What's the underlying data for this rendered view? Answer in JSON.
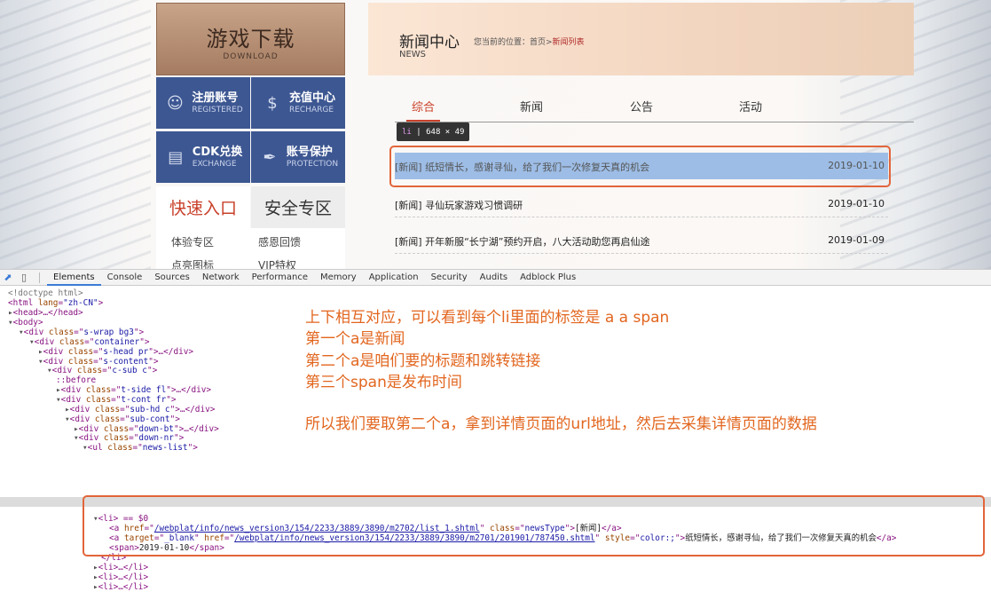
{
  "sidebar": {
    "download": {
      "title": "游戏下载",
      "subtitle": "DOWNLOAD"
    },
    "tiles": [
      {
        "title": "注册账号",
        "subtitle": "REGISTERED",
        "icon": "user-register-icon"
      },
      {
        "title": "充值中心",
        "subtitle": "RECHARGE",
        "icon": "dollar-icon"
      },
      {
        "title": "CDK兑换",
        "subtitle": "EXCHANGE",
        "icon": "gift-icon"
      },
      {
        "title": "账号保护",
        "subtitle": "PROTECTION",
        "icon": "shield-pen-icon"
      }
    ],
    "quick_tabs": [
      "快速入口",
      "安全专区"
    ],
    "links": [
      "体验专区",
      "感恩回馈",
      "点亮图标",
      "VIP特权"
    ]
  },
  "news": {
    "title": "新闻中心",
    "title_en": "NEWS",
    "breadcrumb_prefix": "您当前的位置：首页>",
    "breadcrumb_current": "新闻列表",
    "tabs": [
      "综合",
      "新闻",
      "公告",
      "活动"
    ],
    "active_tab": "综合",
    "inspector_tip": {
      "tag": "li",
      "size": "648 × 49"
    },
    "items": [
      {
        "title": "[新闻] 纸短情长，感谢寻仙，给了我们一次修复天真的机会",
        "date": "2019-01-10"
      },
      {
        "title": "[新闻] 寻仙玩家游戏习惯调研",
        "date": "2019-01-10"
      },
      {
        "title": "[新闻] 开年新服“长宁湖”预约开启，八大活动助您再启仙途",
        "date": "2019-01-09"
      }
    ]
  },
  "devtools": {
    "tabs": [
      "Elements",
      "Console",
      "Sources",
      "Network",
      "Performance",
      "Memory",
      "Application",
      "Security",
      "Audits",
      "Adblock Plus"
    ],
    "active_tab": "Elements",
    "dom": {
      "doctype": "<!doctype html>",
      "html_open": "<html ",
      "html_attr": "lang",
      "html_val": "\"zh-CN\"",
      "head": "<head>…</head>",
      "body": "<body>",
      "lines": [
        {
          "tag": "div",
          "cls": "s-wrap bg3",
          "collapsed": false
        },
        {
          "tag": "div",
          "cls": "container",
          "collapsed": false
        },
        {
          "tag": "div",
          "cls": "s-head pr",
          "collapsed": true
        },
        {
          "tag": "div",
          "cls": "s-content",
          "collapsed": false
        },
        {
          "tag": "div",
          "cls": "c-sub c",
          "collapsed": false
        },
        {
          "tag": "pseudo",
          "text": "::before"
        },
        {
          "tag": "div",
          "cls": "t-side fl",
          "collapsed": true
        },
        {
          "tag": "div",
          "cls": "t-cont fr",
          "collapsed": false
        },
        {
          "tag": "div",
          "cls": "sub-hd c",
          "collapsed": true
        },
        {
          "tag": "div",
          "cls": "sub-cont",
          "collapsed": false
        },
        {
          "tag": "div",
          "cls": "down-bt",
          "collapsed": true
        },
        {
          "tag": "div",
          "cls": "down-nr",
          "collapsed": false
        },
        {
          "tag": "ul",
          "cls": "news-list",
          "collapsed": false
        }
      ],
      "li_selected": "<li> == $0",
      "a1_href": "/webplat/info/news_version3/154/2233/3889/3890/m2702/list_1.shtml",
      "a1_class": "newsType",
      "a1_text": "[新闻]",
      "a2_target": "_blank",
      "a2_href": "/webplat/info/news_version3/154/2233/3889/3890/m2701/201901/787450.shtml",
      "a2_style": "color:;",
      "a2_text": "纸短情长，感谢寻仙，给了我们一次修复天真的机会",
      "span_text": "2019-01-10",
      "li_close": "</li>",
      "li_collapsed": "<li>…</li>"
    }
  },
  "notes": [
    "上下相互对应，可以看到每个li里面的标签是 a a span",
    "第一个a是新闻",
    "第二个a是咱们要的标题和跳转链接",
    "第三个span是发布时间",
    "所以我们要取第二个a，拿到详情页面的url地址，然后去采集详情页面的数据"
  ],
  "colors": {
    "accent": "#e2661f",
    "tile": "#3d5792",
    "active_tab": "#c9402a",
    "highlight": "#9dbde6"
  }
}
